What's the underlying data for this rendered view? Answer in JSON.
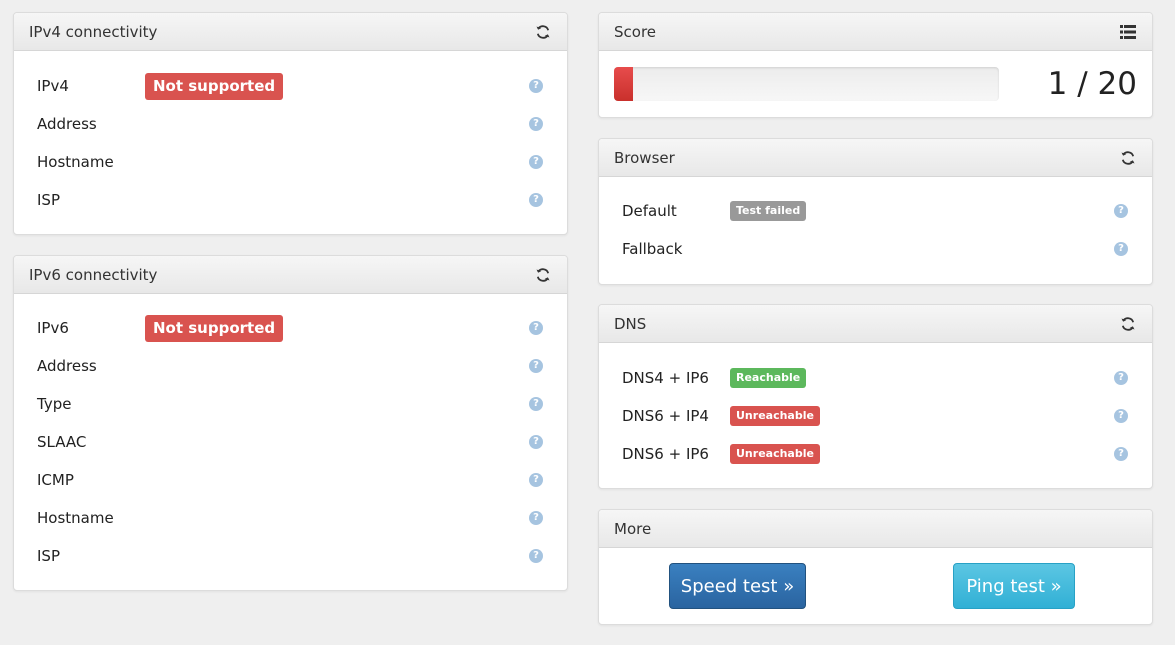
{
  "ipv4": {
    "title": "IPv4 connectivity",
    "refresh_icon": "refresh-icon",
    "rows": [
      {
        "label": "IPv4",
        "badge": "Not supported"
      },
      {
        "label": "Address"
      },
      {
        "label": "Hostname"
      },
      {
        "label": "ISP"
      }
    ]
  },
  "ipv6": {
    "title": "IPv6 connectivity",
    "refresh_icon": "refresh-icon",
    "rows": [
      {
        "label": "IPv6",
        "badge": "Not supported"
      },
      {
        "label": "Address"
      },
      {
        "label": "Type"
      },
      {
        "label": "SLAAC"
      },
      {
        "label": "ICMP"
      },
      {
        "label": "Hostname"
      },
      {
        "label": "ISP"
      }
    ]
  },
  "score": {
    "title": "Score",
    "list_icon": "list-icon",
    "value": 1,
    "max": 20,
    "text": "1 / 20",
    "bar_color": "#d9534f"
  },
  "browser": {
    "title": "Browser",
    "rows": [
      {
        "label": "Default",
        "badge": "Test failed"
      },
      {
        "label": "Fallback"
      }
    ]
  },
  "dns": {
    "title": "DNS",
    "rows": [
      {
        "label": "DNS4 + IP6",
        "badge": "Reachable"
      },
      {
        "label": "DNS6 + IP4",
        "badge": "Unreachable"
      },
      {
        "label": "DNS6 + IP6",
        "badge": "Unreachable"
      }
    ]
  },
  "more": {
    "title": "More",
    "speed_test": "Speed test »",
    "ping_test": "Ping test »"
  },
  "help_glyph": "?",
  "colors": {
    "danger": "#d9534f",
    "success": "#5cb85c",
    "muted": "#999999",
    "primary": "#2d6ca7",
    "info": "#31b0d5"
  }
}
